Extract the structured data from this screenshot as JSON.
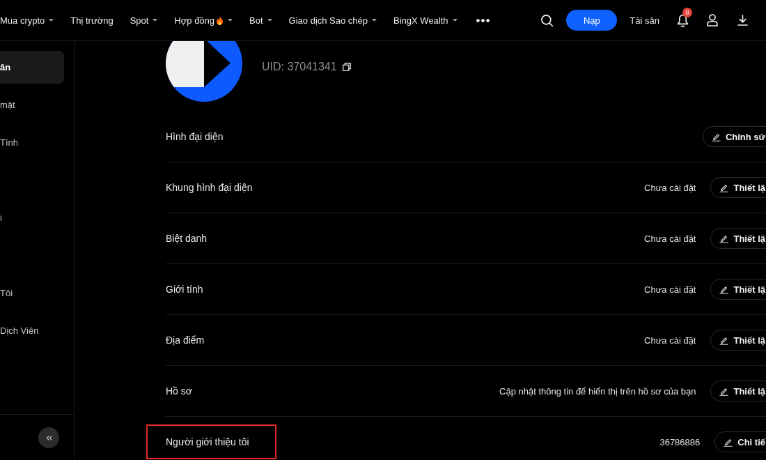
{
  "top_nav": {
    "menu": [
      {
        "label": "Mua crypto",
        "dropdown": true,
        "hot": false
      },
      {
        "label": "Thị trường",
        "dropdown": false,
        "hot": false
      },
      {
        "label": "Spot",
        "dropdown": true,
        "hot": false
      },
      {
        "label": "Hợp đồng",
        "dropdown": true,
        "hot": true
      },
      {
        "label": "Bot",
        "dropdown": true,
        "hot": false
      },
      {
        "label": "Giao dịch Sao chép",
        "dropdown": true,
        "hot": false
      },
      {
        "label": "BingX Wealth",
        "dropdown": true,
        "hot": false
      }
    ],
    "deposit_button": "Nạp",
    "assets_link": "Tài sản",
    "notification_count": "8"
  },
  "sidebar": {
    "items": [
      {
        "label": "ân",
        "selected": true
      },
      {
        "label": "mật",
        "selected": false
      },
      {
        "label": "Tính",
        "selected": false
      },
      {
        "label": "i",
        "selected": false
      },
      {
        "label": "Tôi",
        "selected": false
      },
      {
        "label": "Dịch Viên",
        "selected": false
      }
    ]
  },
  "profile": {
    "uid": "UID: 37041341",
    "rows": [
      {
        "label": "Hình đại diện",
        "button": "Chỉnh sử",
        "highlighted": false
      },
      {
        "label": "Khung hình đại diện",
        "value": "Chưa cài đặt",
        "button": "Thiết lậ",
        "highlighted": false
      },
      {
        "label": "Biệt danh",
        "value": "Chưa cài đặt",
        "button": "Thiết lậ",
        "highlighted": false
      },
      {
        "label": "Giới tính",
        "value": "Chưa cài đặt",
        "button": "Thiết lậ",
        "highlighted": false
      },
      {
        "label": "Địa điểm",
        "value": "Chưa cài đặt",
        "button": "Thiết lậ",
        "highlighted": false
      },
      {
        "label": "Hồ sơ",
        "value": "Cập nhật thông tin để hiển thị trên hồ sơ của bạn",
        "button": "Thiết lậ",
        "highlighted": false
      },
      {
        "label": "Người giới thiệu tôi",
        "value": "36786886",
        "button": "Chi tiế",
        "highlighted": true
      }
    ]
  }
}
